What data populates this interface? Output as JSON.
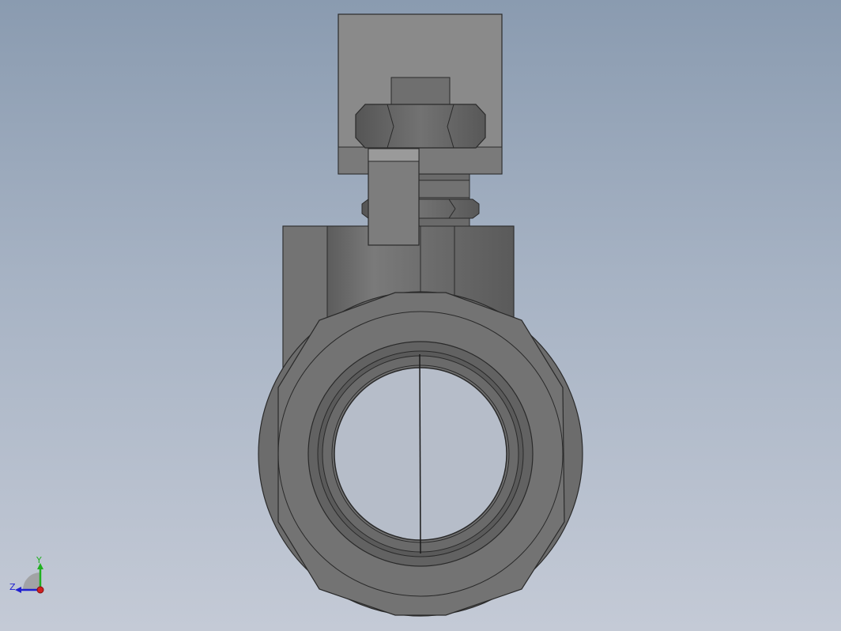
{
  "viewport": {
    "background_top": "#8a9bb0",
    "background_bottom": "#c4cad6"
  },
  "model": {
    "name": "ball-valve",
    "body_color": "#6e6e6e",
    "handle_color": "#8a8a8a"
  },
  "triad": {
    "y_label": "Y",
    "z_label": "Z",
    "y_color": "#20b020",
    "z_color": "#2020d0",
    "x_color": "#d02020"
  }
}
